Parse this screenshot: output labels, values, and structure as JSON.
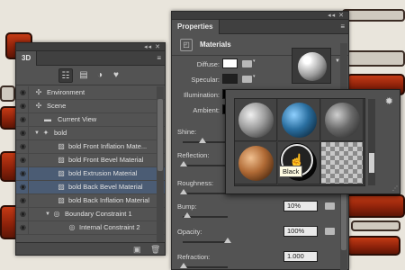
{
  "panel3d": {
    "tab": "3D",
    "grip_buttons": "◂◂ ✕",
    "filter_icons": [
      "scene-filter-icon",
      "mesh-filter-icon",
      "material-filter-icon",
      "light-filter-icon"
    ],
    "rows": [
      {
        "label": "Environment",
        "icon": "environment-icon",
        "level": 1,
        "selected": false
      },
      {
        "label": "Scene",
        "icon": "scene-icon",
        "level": 1,
        "selected": false
      },
      {
        "label": "Current View",
        "icon": "camera-icon",
        "level": 2,
        "selected": false
      },
      {
        "label": "bold",
        "icon": "mesh-icon",
        "level": 1,
        "selected": false
      },
      {
        "label": "bold Front Inflation Mate...",
        "icon": "material-icon",
        "level": 3,
        "selected": false
      },
      {
        "label": "bold Front Bevel Material",
        "icon": "material-icon",
        "level": 3,
        "selected": false
      },
      {
        "label": "bold Extrusion Material",
        "icon": "material-icon",
        "level": 3,
        "selected": true
      },
      {
        "label": "bold Back Bevel Material",
        "icon": "material-icon",
        "level": 3,
        "selected": true
      },
      {
        "label": "bold Back Inflation Material",
        "icon": "material-icon",
        "level": 3,
        "selected": false
      },
      {
        "label": "Boundary Constraint 1",
        "icon": "constraint-icon",
        "level": 2,
        "selected": false
      },
      {
        "label": "Internal Constraint 2",
        "icon": "constraint-icon",
        "level": 3,
        "selected": false
      }
    ]
  },
  "properties": {
    "tab": "Properties",
    "section_title": "Materials",
    "diffuse_label": "Diffuse:",
    "specular_label": "Specular:",
    "illumination_label": "Illumination:",
    "ambient_label": "Ambient:",
    "shine_label": "Shine:",
    "reflection_label": "Reflection:",
    "roughness_label": "Roughness:",
    "bump_label": "Bump:",
    "bump_value": "10%",
    "opacity_label": "Opacity:",
    "opacity_value": "100%",
    "refraction_label": "Refraction:",
    "refraction_value": "1.000",
    "colors": {
      "diffuse": "#ffffff",
      "specular": "#202020",
      "illumination": "#000000",
      "ambient": "#000000"
    }
  },
  "picker": {
    "tooltip": "Black",
    "materials": [
      {
        "name": "metal-grey",
        "color": "#8a8a8a"
      },
      {
        "name": "blue-glass",
        "color": "#2a6fa0"
      },
      {
        "name": "dark-grey",
        "color": "#6a6a6a"
      },
      {
        "name": "copper",
        "color": "#b06a35"
      },
      {
        "name": "black",
        "color": "#111111"
      },
      {
        "name": "checker",
        "color": "#b0b0b0"
      }
    ]
  }
}
